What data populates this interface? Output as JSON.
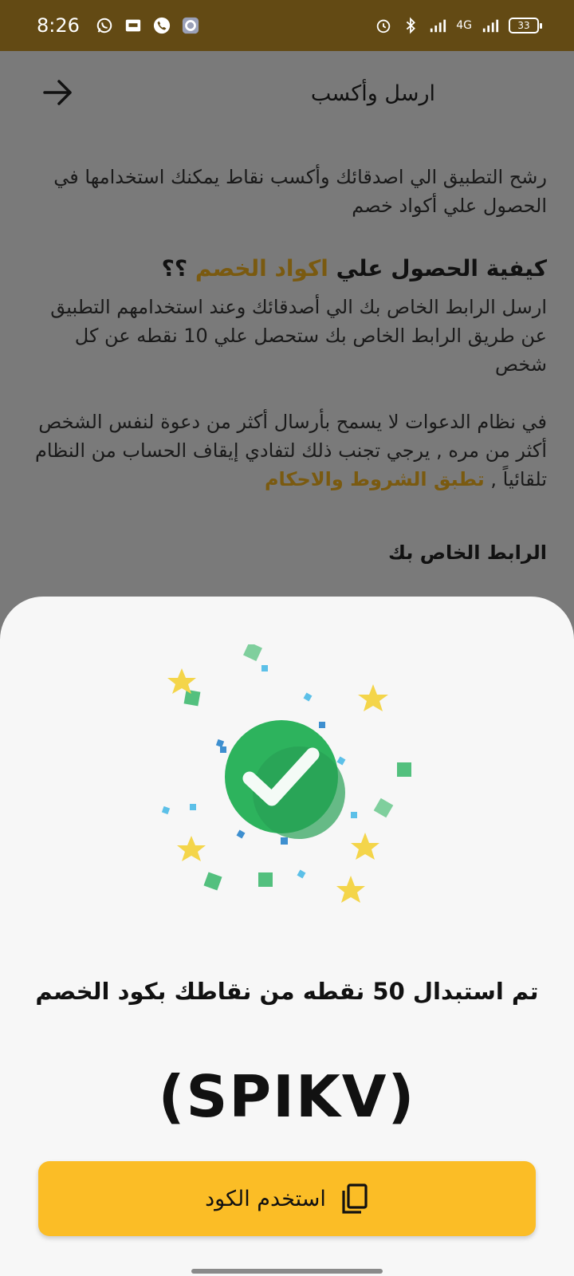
{
  "status_bar": {
    "time": "8:26",
    "network": "4G",
    "battery": "33",
    "icons": [
      "whatsapp-icon",
      "gallery-icon",
      "phone-icon",
      "settings-icon",
      "alarm-icon",
      "bluetooth-icon",
      "signal-icon",
      "signal-4g-icon",
      "battery-icon"
    ]
  },
  "page": {
    "title": "ارسل وأكسب",
    "intro": "رشح التطبيق الي اصدقائك وأكسب نقاط يمكنك استخدامها في الحصول علي أكواد خصم",
    "how_title_main": "كيفية الحصول علي",
    "how_title_accent": "اكواد الخصم",
    "how_title_suffix": "؟؟",
    "how_text": "ارسل الرابط الخاص بك الي أصدقائك وعند استخدامهم التطبيق عن طريق الرابط الخاص بك ستحصل علي 10 نقطه عن كل شخص",
    "policy_text": "في نظام الدعوات لا يسمح بأرسال أكثر من دعوة لنفس الشخص أكثر من مره , يرجي تجنب ذلك لتفادي إيقاف الحساب من النظام تلقائياً ,",
    "policy_link": "تطبق الشروط والاحكام",
    "link_label": "الرابط الخاص بك"
  },
  "sheet": {
    "message": "تم استبدال 50 نقطه من نقاطك بكود الخصم",
    "code": "(SPIKV)",
    "use_button_label": "استخدم الكود"
  },
  "colors": {
    "status_bar": "#634a14",
    "accent": "#7a5a10",
    "button": "#fbbd26",
    "success": "#2db35d"
  }
}
